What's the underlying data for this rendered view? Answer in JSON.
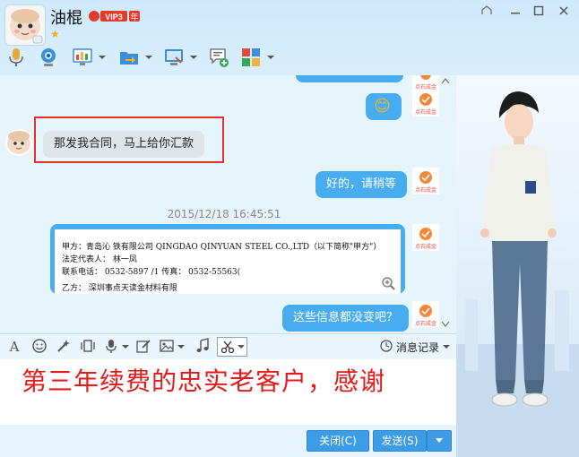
{
  "header": {
    "name": "油棍",
    "vip_label": "VIP3",
    "vip_year": "年"
  },
  "chat": {
    "msg_mine_emoji": "😊",
    "msg_theirs": "那发我合同，马上给你汇款",
    "msg_mine_ok": "好的，请稍等",
    "timestamp": "2015/12/18 16:45:51",
    "msg_mine_question": "这些信息都没变吧？",
    "contract": {
      "line1": "甲方：青岛沁      铁有限公司 QINGDAO QINYUAN STEEL CO.,LTD（以下简称\"甲方\"）",
      "line2": "法定代表人：    林一凤",
      "line3": "联系电话：   0532-5897  /1                      传真：  0532-55563(",
      "line4": "乙方：    深圳事点天读金材料有限"
    }
  },
  "input_toolbar": {
    "msg_record": "消息记录"
  },
  "promo_text": "第三年续费的忠实老客户，感谢",
  "buttons": {
    "close": "关闭(C)",
    "send": "发送(S)"
  },
  "colors": {
    "bubble_blue": "#48adf0",
    "highlight": "#e03030",
    "promo": "#e21a1a"
  }
}
